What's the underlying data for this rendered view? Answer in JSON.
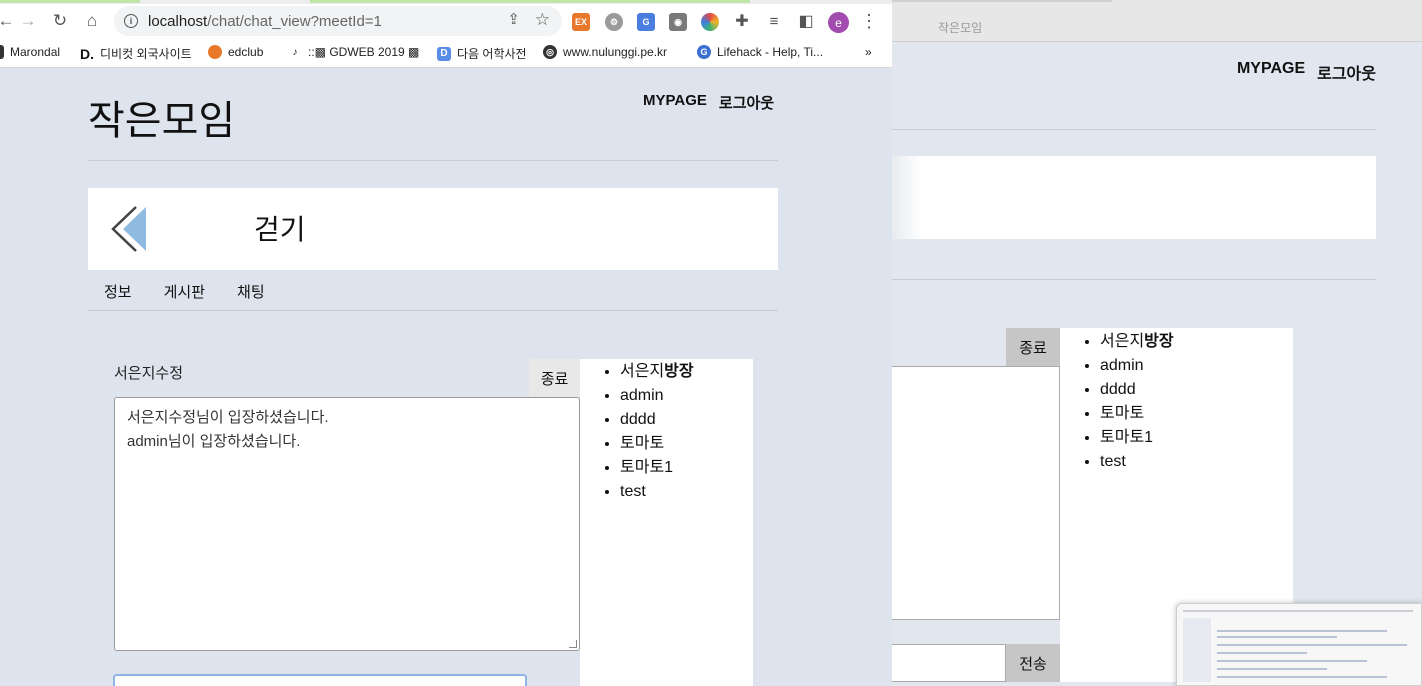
{
  "browser": {
    "url_host": "localhost",
    "url_path": "/chat/chat_view?meetId=1",
    "avatar_letter": "e",
    "extensions": [
      {
        "name": "ex-extension-icon",
        "text": "EX",
        "color": "#e8792b"
      },
      {
        "name": "gear-extension-icon",
        "text": "⚙",
        "color": "#8e8e8e"
      },
      {
        "name": "translate-extension-icon",
        "text": "G",
        "color": "#4a7fe0"
      },
      {
        "name": "camera-extension-icon",
        "text": "◉",
        "color": "#7a7a7a"
      },
      {
        "name": "color-wheel-extension-icon",
        "text": "◍",
        "color": "#e0494b"
      }
    ]
  },
  "bookmarks": [
    {
      "label": "Marondal"
    },
    {
      "label": "디비컷 외국사이트",
      "icon": "D."
    },
    {
      "label": "edclub"
    },
    {
      "label": "::▩ GDWEB 2019 ▩"
    },
    {
      "label": "다음 어학사전"
    },
    {
      "label": "www.nulunggi.pe.kr"
    },
    {
      "label": "Lifehack - Help, Ti..."
    }
  ],
  "bookmarks_more": "»",
  "site": {
    "title": "작은모임",
    "nav": [
      "MYPAGE",
      "로그아웃"
    ]
  },
  "meeting": {
    "name": "걷기",
    "tabs": [
      "정보",
      "게시판",
      "채팅"
    ]
  },
  "chat": {
    "current_user": "서은지수정",
    "end_label": "종료",
    "send_label": "전송",
    "messages": [
      "서은지수정님이 입장하셨습니다.",
      "admin님이 입장하셨습니다."
    ],
    "owner": {
      "name": "서은지",
      "badge": "방장"
    },
    "participants": [
      "admin",
      "dddd",
      "토마토",
      "토마토1",
      "test"
    ]
  },
  "background_window": {
    "title": "작은모임"
  }
}
